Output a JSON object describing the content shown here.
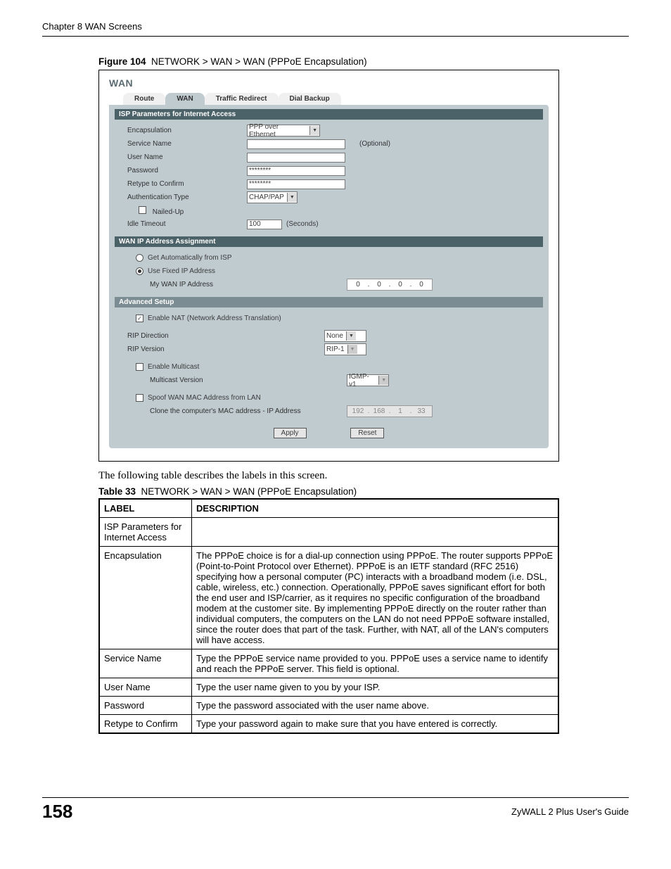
{
  "doc_header": "Chapter 8 WAN Screens",
  "figure_label": "Figure 104",
  "figure_title": "NETWORK > WAN > WAN (PPPoE Encapsulation)",
  "screenshot": {
    "title": "WAN",
    "tabs": [
      "Route",
      "WAN",
      "Traffic Redirect",
      "Dial Backup"
    ],
    "active_tab": 1,
    "sections": {
      "isp_header": "ISP Parameters for Internet Access",
      "encapsulation_label": "Encapsulation",
      "encapsulation_value": "PPP over Ethernet",
      "service_name_label": "Service Name",
      "service_name_value": "",
      "optional": "(Optional)",
      "user_name_label": "User Name",
      "user_name_value": "",
      "password_label": "Password",
      "password_value": "********",
      "retype_label": "Retype to Confirm",
      "retype_value": "********",
      "auth_type_label": "Authentication Type",
      "auth_type_value": "CHAP/PAP",
      "nailed_up_label": "Nailed-Up",
      "idle_timeout_label": "Idle Timeout",
      "idle_timeout_value": "100",
      "idle_timeout_unit": "(Seconds)",
      "wan_ip_header": "WAN IP Address Assignment",
      "get_auto_label": "Get Automatically from ISP",
      "use_fixed_label": "Use Fixed IP Address",
      "my_wan_ip_label": "My WAN IP Address",
      "my_wan_ip": [
        "0",
        "0",
        "0",
        "0"
      ],
      "advanced_header": "Advanced Setup",
      "enable_nat_label": "Enable NAT (Network Address Translation)",
      "rip_direction_label": "RIP Direction",
      "rip_direction_value": "None",
      "rip_version_label": "RIP Version",
      "rip_version_value": "RIP-1",
      "enable_multicast_label": "Enable Multicast",
      "multicast_version_label": "Multicast Version",
      "multicast_version_value": "IGMP-v1",
      "spoof_mac_label": "Spoof WAN MAC Address from LAN",
      "clone_mac_label": "Clone the computer's MAC address - IP Address",
      "clone_mac_ip": [
        "192",
        "168",
        "1",
        "33"
      ],
      "apply_btn": "Apply",
      "reset_btn": "Reset"
    }
  },
  "body_text": "The following table describes the labels in this screen.",
  "table_label": "Table 33",
  "table_title": "NETWORK > WAN > WAN (PPPoE Encapsulation)",
  "table_headers": [
    "LABEL",
    "DESCRIPTION"
  ],
  "table_rows": [
    {
      "label": "ISP Parameters for Internet Access",
      "desc": ""
    },
    {
      "label": "Encapsulation",
      "desc": "The PPPoE choice is for a dial-up connection using PPPoE. The router supports PPPoE (Point-to-Point Protocol over Ethernet). PPPoE is an IETF standard (RFC 2516) specifying how a personal computer (PC) interacts with a broadband modem (i.e. DSL, cable, wireless, etc.) connection. Operationally, PPPoE saves significant effort for both the end user and ISP/carrier, as it requires no specific configuration of the broadband modem at the customer site. By implementing PPPoE directly on the router rather than individual computers, the computers on the LAN do not need PPPoE software installed, since the router does that part of the task. Further, with NAT, all of the LAN's computers will have access."
    },
    {
      "label": "Service Name",
      "desc": "Type the PPPoE service name provided to you. PPPoE uses a service name to identify and reach the PPPoE server. This field is optional."
    },
    {
      "label": "User Name",
      "desc": "Type the user name given to you by your ISP."
    },
    {
      "label": "Password",
      "desc": "Type the password associated with the user name above."
    },
    {
      "label": "Retype to Confirm",
      "desc": "Type your password again to make sure that you have entered is correctly."
    }
  ],
  "page_number": "158",
  "guide_name": "ZyWALL 2 Plus User's Guide"
}
